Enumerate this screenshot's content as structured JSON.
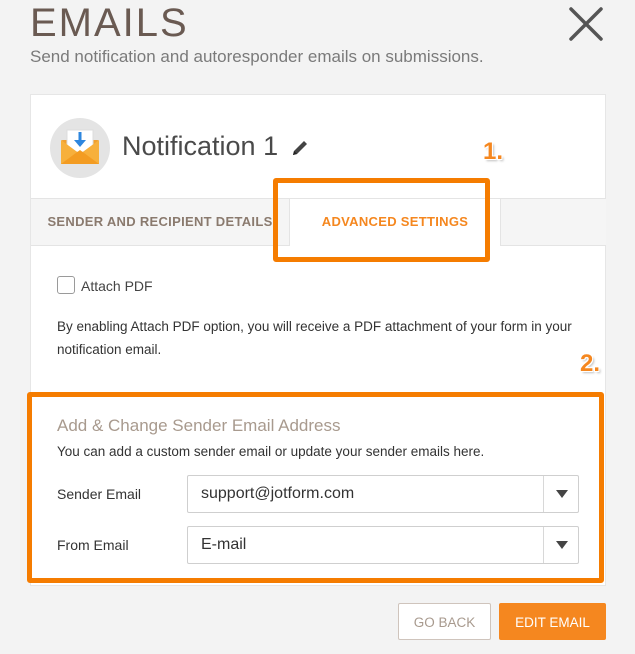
{
  "header": {
    "title": "EMAILS",
    "subtitle": "Send notification and autoresponder emails on submissions.",
    "close_icon": "close-icon"
  },
  "notification": {
    "title": "Notification 1",
    "icon": "envelope-download-icon",
    "edit_icon": "pencil-icon"
  },
  "annotations": {
    "step1": "1.",
    "step2": "2.",
    "highlight_color": "#f57c00"
  },
  "tabs": [
    {
      "label": "SENDER AND RECIPIENT DETAILS",
      "active": false
    },
    {
      "label": "ADVANCED SETTINGS",
      "active": true
    }
  ],
  "attach_pdf": {
    "label": "Attach PDF",
    "checked": false,
    "description": "By enabling Attach PDF option, you will receive a PDF attachment of your form in your notification email."
  },
  "sender_section": {
    "title": "Add & Change Sender Email Address",
    "description": "You can add a custom sender email or update your sender emails here.",
    "fields": [
      {
        "label": "Sender Email",
        "value": "support@jotform.com"
      },
      {
        "label": "From Email",
        "value": "E-mail"
      }
    ]
  },
  "footer": {
    "back_label": "GO BACK",
    "edit_label": "EDIT EMAIL"
  },
  "colors": {
    "accent": "#f5871f",
    "title": "#6a5a52"
  }
}
